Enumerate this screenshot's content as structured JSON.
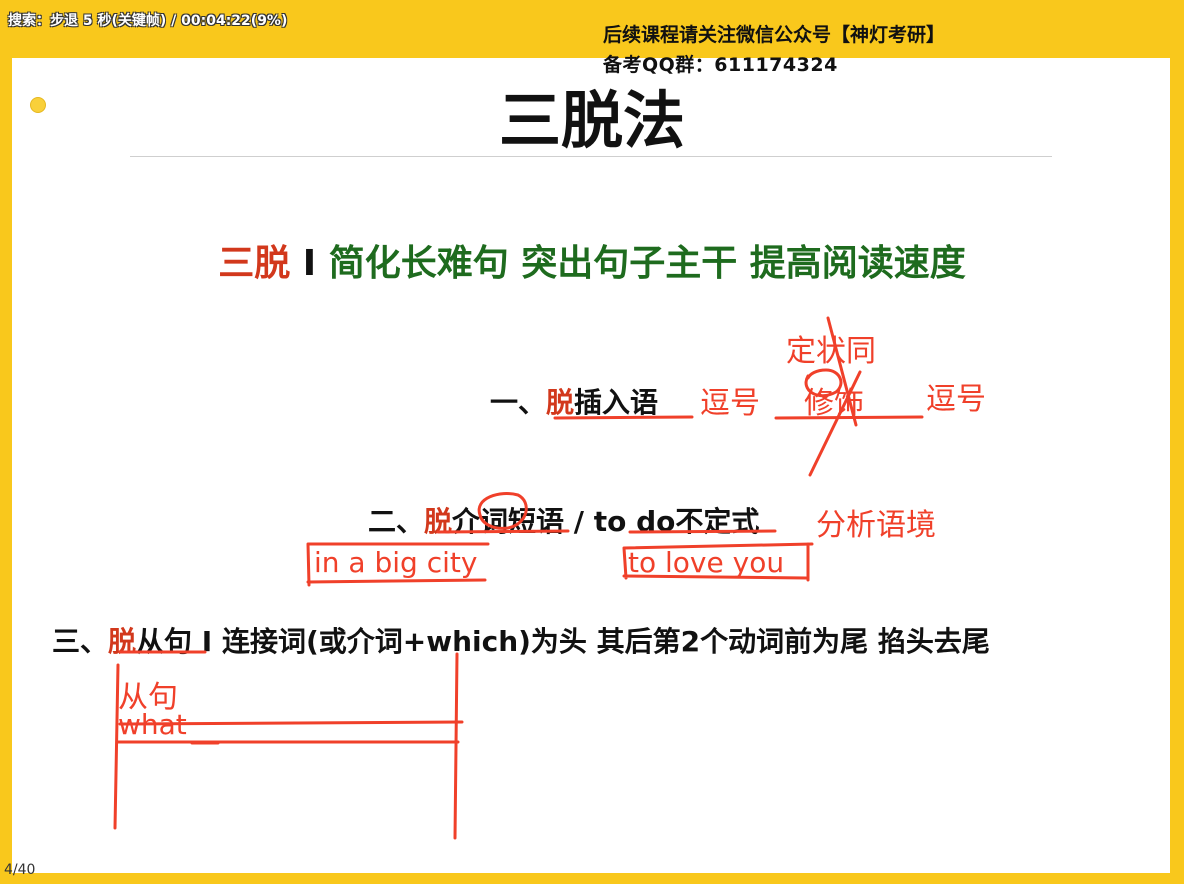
{
  "player": {
    "status": "搜索：步退 5 秒(关键帧) / 00:04:22(9%)"
  },
  "watermark": {
    "line1": "后续课程请关注微信公众号【神灯考研】",
    "line2": "备考QQ群：611174324"
  },
  "slide": {
    "title": "三脱法",
    "subtitle": {
      "prefix": "三脱",
      "sep": " I ",
      "text": "简化长难句 突出句子主干 提高阅读速度"
    },
    "item1": {
      "num": "一、",
      "key": "脱",
      "rest": "插入语"
    },
    "item2": {
      "num": "二、",
      "key": "脱",
      "rest": "介词短语 / ",
      "eng": "to do",
      "tail": "不定式"
    },
    "item3": {
      "num": "三、",
      "key": "脱",
      "rest": "从句 I 连接词(或介词+which)为头 其后第2个动词前为尾 掐头去尾"
    },
    "page": "4/40"
  },
  "annotations": {
    "comma1": "逗号",
    "comma2": "逗号",
    "dingzhuang": "定状同",
    "xiushi": "修饰",
    "fenxi": "分析语境",
    "example1": "in a big city",
    "example2": "to love you",
    "congju": "从句",
    "what": "what"
  }
}
